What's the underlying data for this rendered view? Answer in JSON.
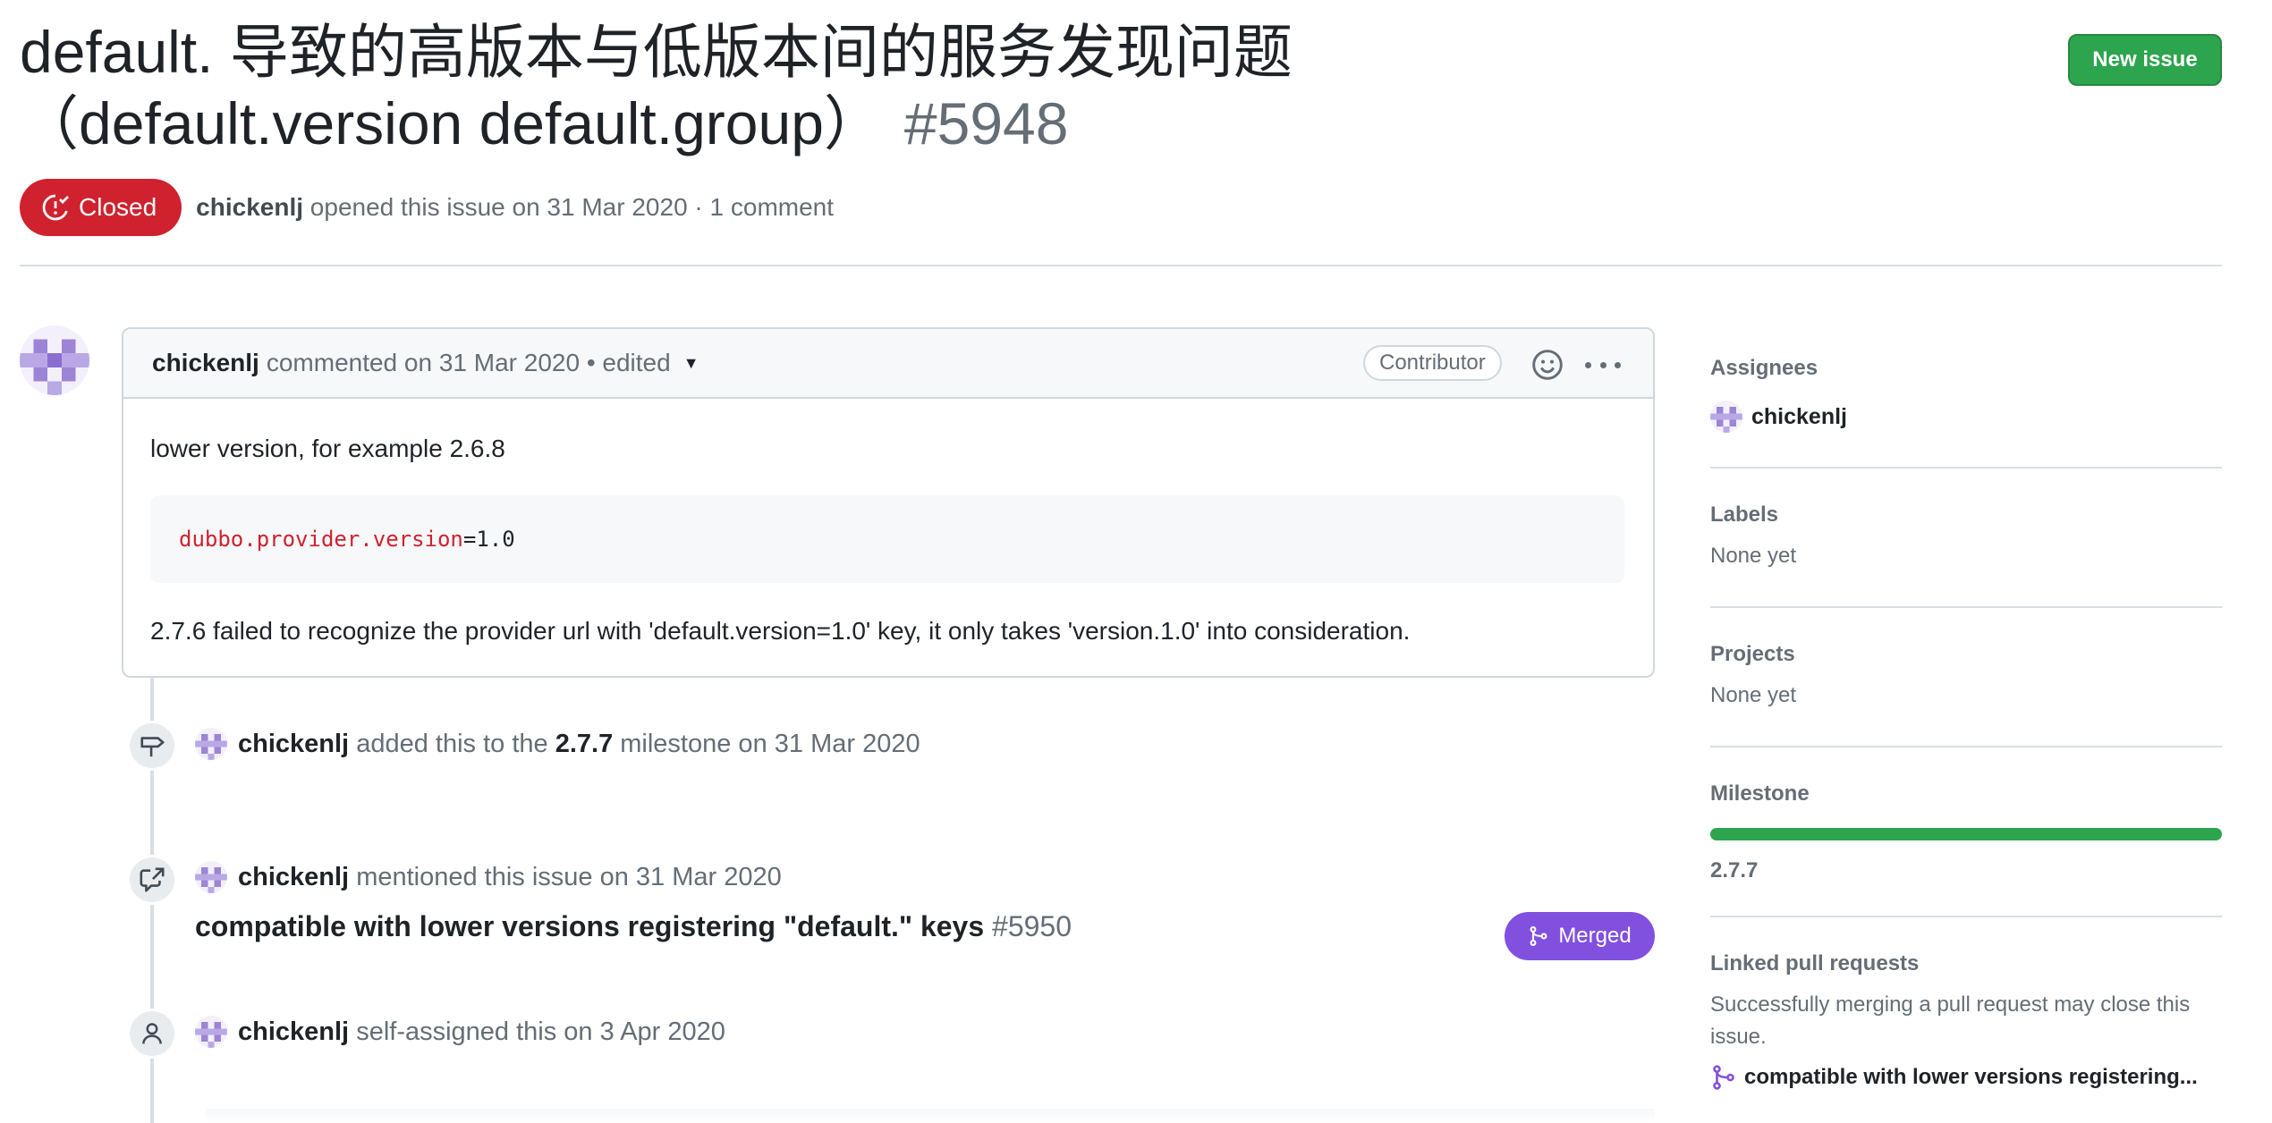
{
  "issue": {
    "title": "default. 导致的高版本与低版本间的服务发现问题（default.version default.group）",
    "number": "#5948",
    "state": "Closed",
    "author": "chickenlj",
    "meta_text": "opened this issue on 31 Mar 2020 · 1 comment"
  },
  "header": {
    "new_issue_label": "New issue"
  },
  "comment": {
    "author": "chickenlj",
    "meta": "commented on 31 Mar 2020 • edited",
    "role_badge": "Contributor",
    "paragraph1": "lower version, for example 2.6.8",
    "code_key": "dubbo.provider.version",
    "code_value": "=1.0",
    "paragraph2": "2.7.6 failed to recognize the provider url with 'default.version=1.0' key, it only takes 'version.1.0' into consideration."
  },
  "timeline": {
    "milestone_event": {
      "actor": "chickenlj",
      "pre": "added this to the",
      "milestone": "2.7.7",
      "post": "milestone on 31 Mar 2020"
    },
    "mention_event": {
      "actor": "chickenlj",
      "text": "mentioned this issue on 31 Mar 2020",
      "pr_title": "compatible with lower versions registering \"default.\" keys",
      "pr_number": "#5950",
      "pr_state": "Merged"
    },
    "assign_event": {
      "actor": "chickenlj",
      "text": "self-assigned this on 3 Apr 2020"
    }
  },
  "sidebar": {
    "assignees_heading": "Assignees",
    "assignee": "chickenlj",
    "labels_heading": "Labels",
    "labels_value": "None yet",
    "projects_heading": "Projects",
    "projects_value": "None yet",
    "milestone_heading": "Milestone",
    "milestone_value": "2.7.7",
    "milestone_progress": 1.0,
    "linked_heading": "Linked pull requests",
    "linked_text": "Successfully merging a pull request may close this issue.",
    "linked_pr": "compatible with lower versions registering..."
  },
  "colors": {
    "closed": "#cf222e",
    "merged": "#8250df",
    "green": "#2da44e"
  },
  "icons": [
    "issue-closed-icon",
    "smiley-icon",
    "kebab-icon",
    "milestone-icon",
    "cross-reference-icon",
    "person-icon",
    "git-merge-icon",
    "git-pull-request-icon"
  ]
}
